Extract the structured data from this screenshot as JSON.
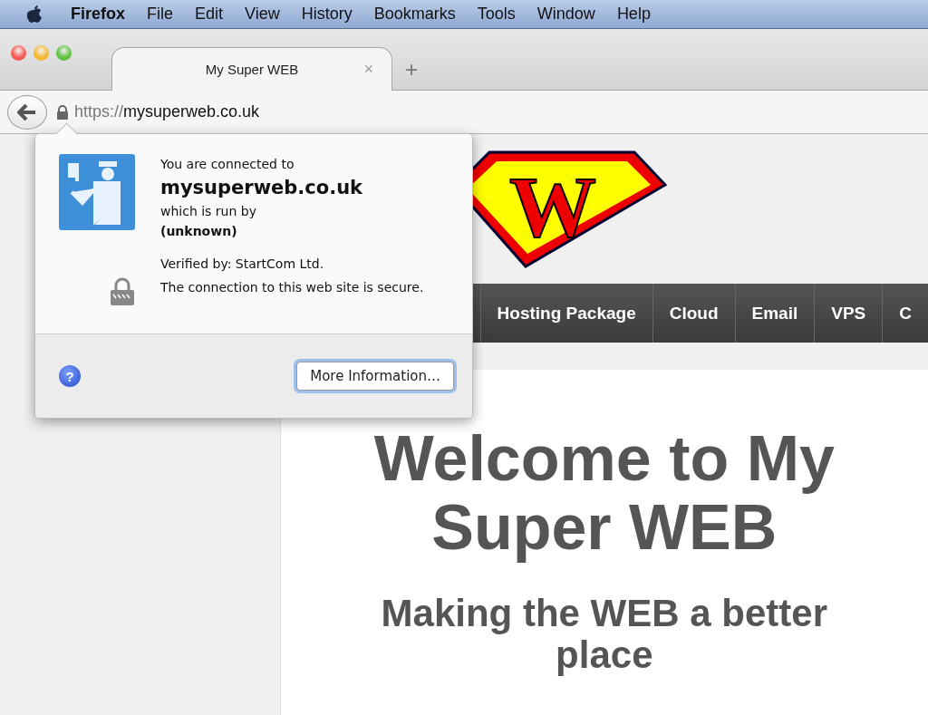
{
  "menu_bar": {
    "app": "Firefox",
    "items": [
      "File",
      "Edit",
      "View",
      "History",
      "Bookmarks",
      "Tools",
      "Window",
      "Help"
    ]
  },
  "tabs": [
    {
      "label": "My Super WEB",
      "selected": true,
      "close": "×"
    }
  ],
  "new_tab": "+",
  "address_bar": {
    "scheme": "https://",
    "host": "mysuperweb.co.uk"
  },
  "site": {
    "logo_letter": "W",
    "nav": [
      "Hosting Package",
      "Cloud",
      "Email",
      "VPS",
      "C"
    ],
    "title": "Welcome to My Super WEB",
    "subtitle": "Making the WEB a better place"
  },
  "identity_popup": {
    "intro": "You are connected to",
    "host": "mysuperweb.co.uk",
    "run_by_label": "which is run by",
    "owner": "(unknown)",
    "verifier": "Verified by: StartCom Ltd.",
    "encryption": "The connection to this web site is secure.",
    "help": "?",
    "more_button": "More Information…"
  }
}
